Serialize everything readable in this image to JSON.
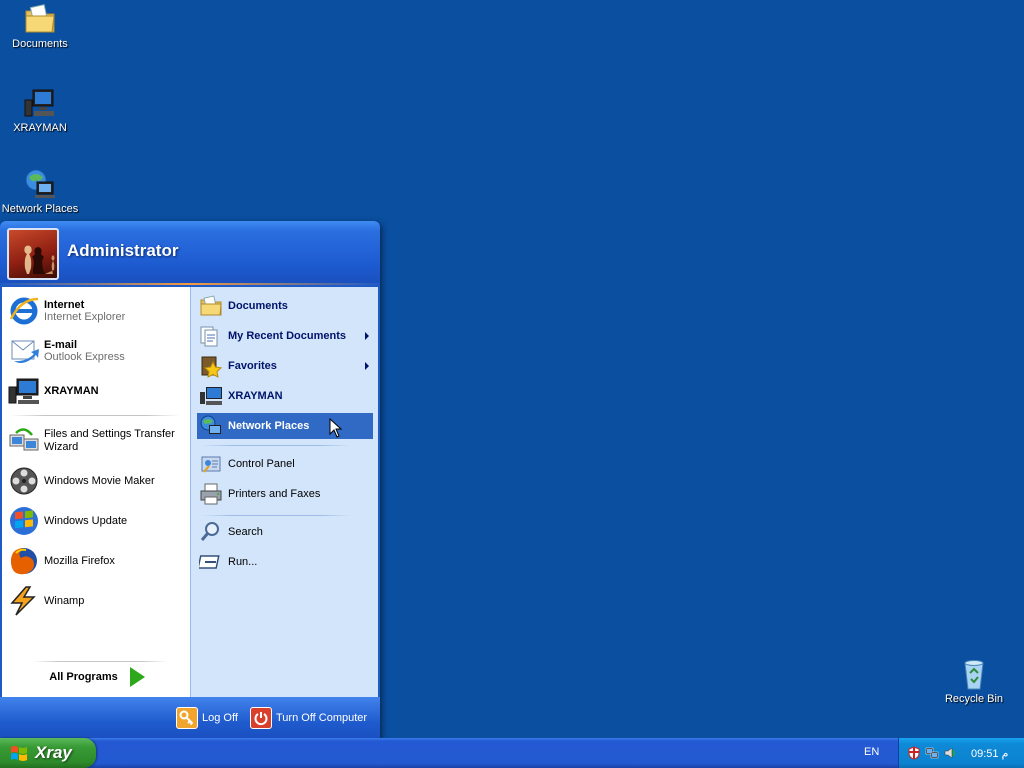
{
  "desktop": {
    "icons": [
      {
        "label": "Documents"
      },
      {
        "label": "XRAYMAN"
      },
      {
        "label": "Network Places"
      },
      {
        "label": "Recycle Bin"
      }
    ]
  },
  "start_menu": {
    "user_name": "Administrator",
    "pinned": [
      {
        "title": "Internet",
        "subtitle": "Internet Explorer",
        "icon": "internet-explorer-icon"
      },
      {
        "title": "E-mail",
        "subtitle": "Outlook Express",
        "icon": "outlook-express-icon"
      },
      {
        "title": "XRAYMAN",
        "icon": "computer-icon"
      }
    ],
    "recent": [
      {
        "label": "Files and Settings Transfer Wizard",
        "icon": "transfer-wizard-icon"
      },
      {
        "label": "Windows Movie Maker",
        "icon": "movie-maker-icon"
      },
      {
        "label": "Windows Update",
        "icon": "windows-update-icon"
      },
      {
        "label": "Mozilla Firefox",
        "icon": "firefox-icon"
      },
      {
        "label": "Winamp",
        "icon": "winamp-icon"
      }
    ],
    "all_programs": "All Programs",
    "places": [
      {
        "label": "Documents",
        "icon": "documents-folder-icon"
      },
      {
        "label": "My Recent Documents",
        "icon": "recent-documents-icon"
      },
      {
        "label": "Favorites",
        "icon": "favorites-icon"
      },
      {
        "label": "XRAYMAN",
        "icon": "computer-icon"
      },
      {
        "label": "Network Places",
        "icon": "network-places-icon"
      }
    ],
    "system": [
      {
        "label": "Control Panel",
        "icon": "control-panel-icon"
      },
      {
        "label": "Printers and Faxes",
        "icon": "printer-icon"
      }
    ],
    "tools": [
      {
        "label": "Search",
        "icon": "search-icon"
      },
      {
        "label": "Run...",
        "icon": "run-icon"
      }
    ],
    "footer": {
      "log_off": "Log Off",
      "turn_off": "Turn Off Computer"
    }
  },
  "taskbar": {
    "start_label": "Xray",
    "language": "EN",
    "clock": "09:51 م"
  },
  "colors": {
    "desktop": "#0a4fa0",
    "highlight": "#316ac5",
    "start_green": "#389b35"
  }
}
